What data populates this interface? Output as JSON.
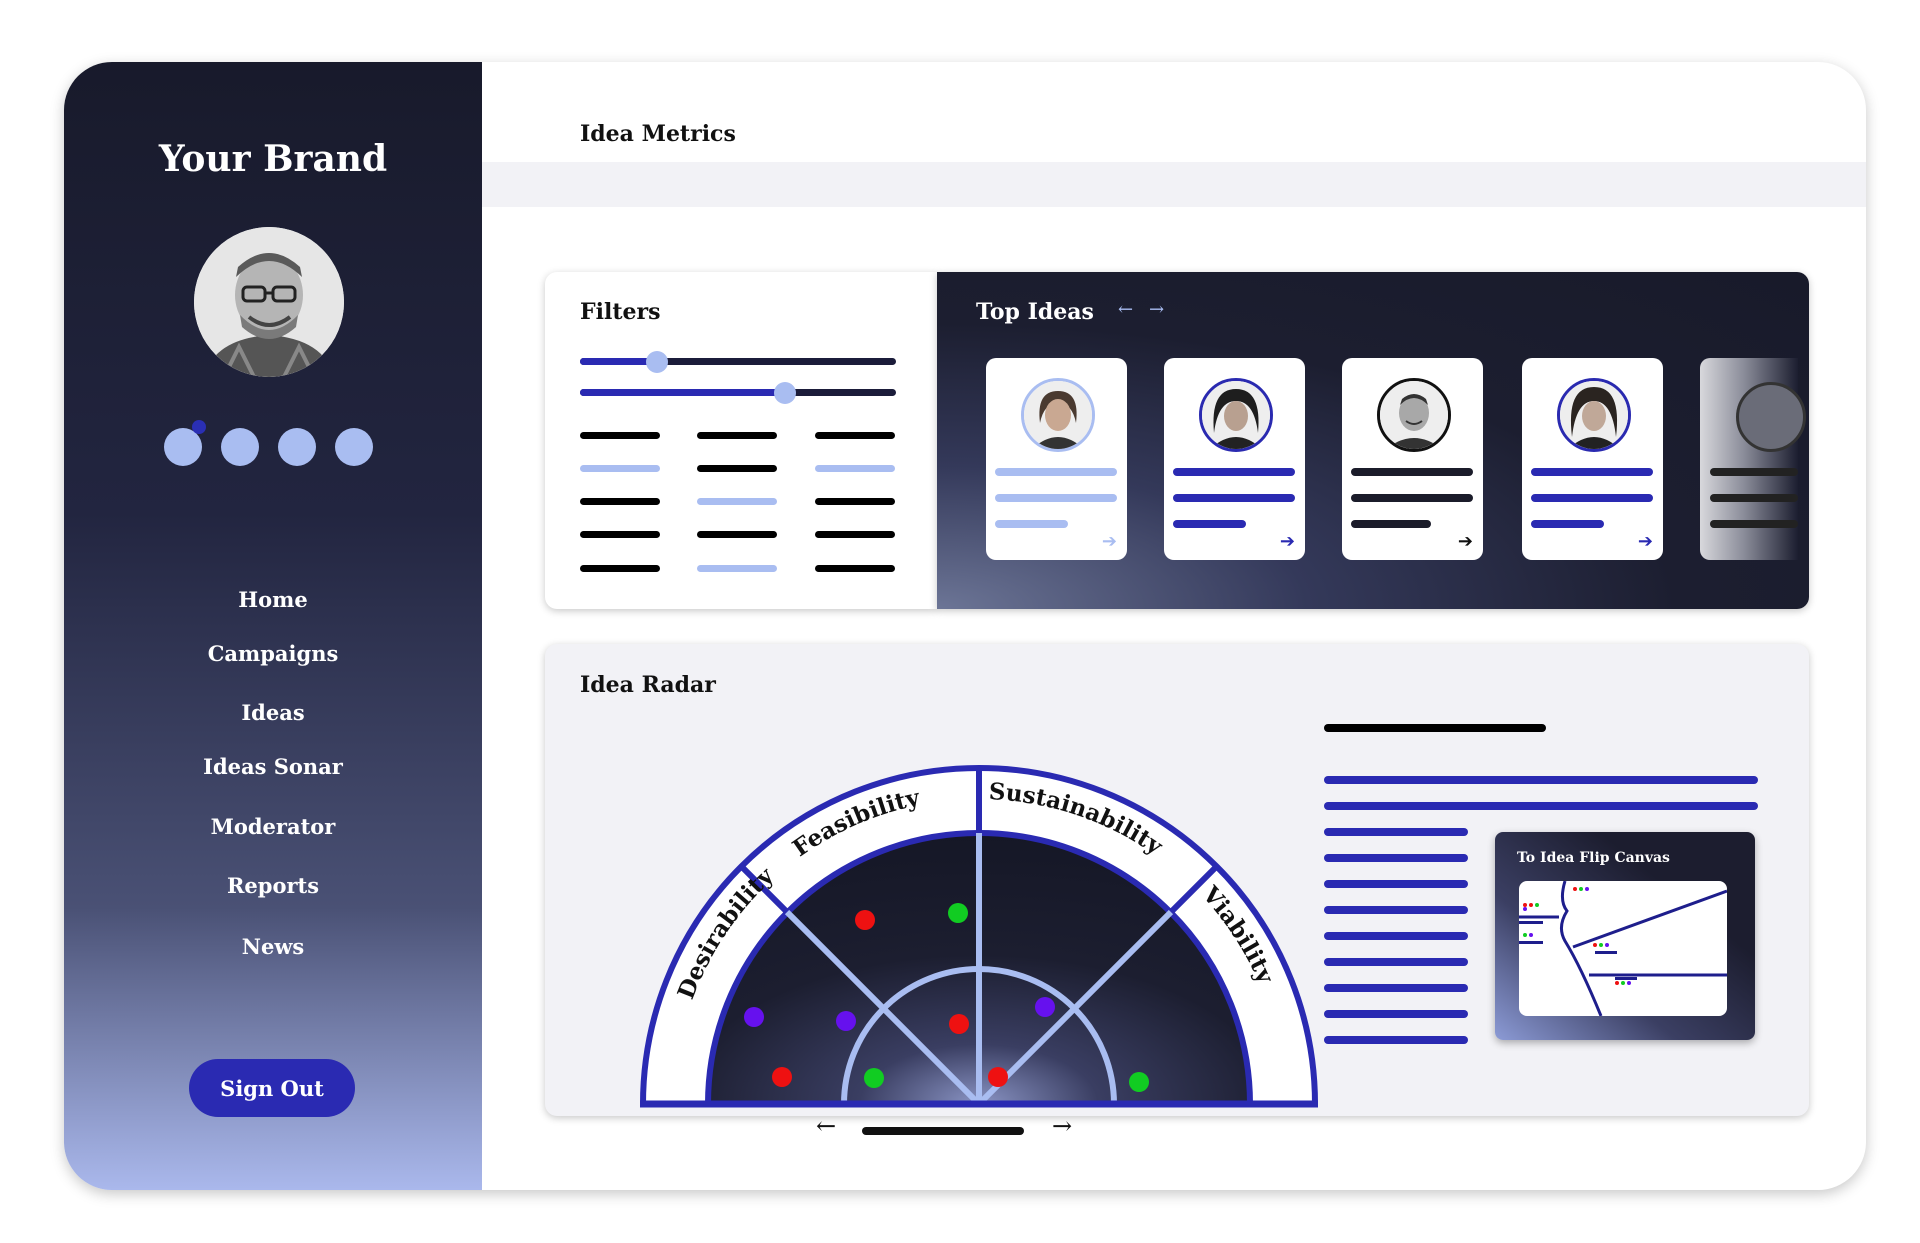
{
  "sidebar": {
    "brand": "Your Brand",
    "nav": [
      "Home",
      "Campaigns",
      "Ideas",
      "Ideas Sonar",
      "Moderator",
      "Reports",
      "News"
    ],
    "sign_out": "Sign Out"
  },
  "header": {
    "title": "Idea Metrics"
  },
  "filters": {
    "title": "Filters"
  },
  "top_ideas": {
    "title": "Top Ideas",
    "prev_icon": "arrow-left-icon",
    "next_icon": "arrow-right-icon"
  },
  "radar": {
    "title": "Idea Radar",
    "segments": [
      "Desirability",
      "Feasibility",
      "Sustainability",
      "Viability"
    ]
  },
  "canvas_link": {
    "title": "To Idea Flip Canvas"
  },
  "colors": {
    "accent": "#2a2ab2",
    "light_accent": "#a9bdf1",
    "dark": "#181a2b",
    "dot_red": "#ee1111",
    "dot_green": "#11cc22",
    "dot_purple": "#6611ee"
  }
}
